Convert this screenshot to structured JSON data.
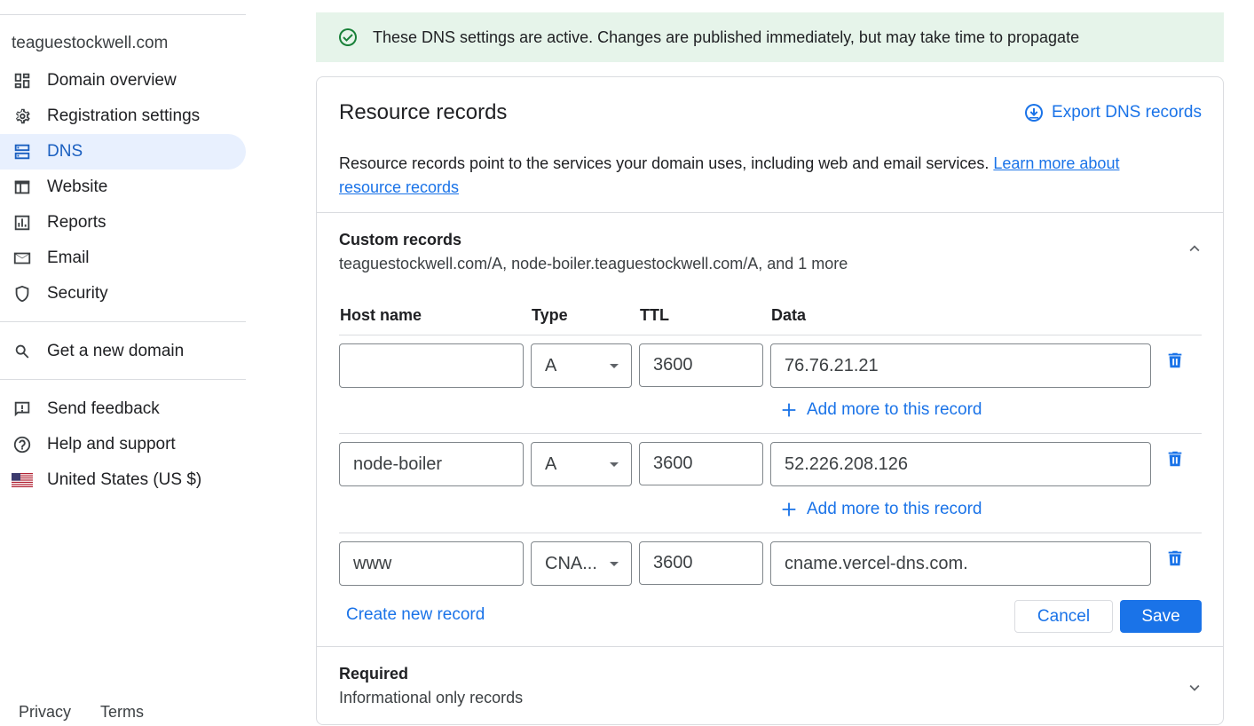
{
  "sidebar": {
    "domain": "teaguestockwell.com",
    "nav": [
      {
        "label": "Domain overview",
        "icon": "dashboard-icon"
      },
      {
        "label": "Registration settings",
        "icon": "gear-icon"
      },
      {
        "label": "DNS",
        "icon": "dns-icon",
        "active": true
      },
      {
        "label": "Website",
        "icon": "website-icon"
      },
      {
        "label": "Reports",
        "icon": "reports-icon"
      },
      {
        "label": "Email",
        "icon": "email-icon"
      },
      {
        "label": "Security",
        "icon": "shield-icon"
      }
    ],
    "get_domain": "Get a new domain",
    "send_feedback": "Send feedback",
    "help": "Help and support",
    "region": "United States (US $)",
    "privacy": "Privacy",
    "terms": "Terms"
  },
  "banner": {
    "text": "These DNS settings are active. Changes are published immediately, but may take time to propagate",
    "color": "#e6f4ea"
  },
  "card": {
    "title": "Resource records",
    "export_label": "Export DNS records",
    "description": "Resource records point to the services your domain uses, including web and email services. ",
    "learn_more_1": "Learn more about",
    "learn_more_2": "resource records",
    "custom": {
      "title": "Custom records",
      "summary": "teaguestockwell.com/A, node-boiler.teaguestockwell.com/A, and 1 more"
    },
    "columns": {
      "host": "Host name",
      "type": "Type",
      "ttl": "TTL",
      "data": "Data"
    },
    "records": [
      {
        "host": "",
        "type": "A",
        "ttl": "3600",
        "data": "76.76.21.21",
        "add_more": "Add more to this record"
      },
      {
        "host": "node-boiler",
        "type": "A",
        "ttl": "3600",
        "data": "52.226.208.126",
        "add_more": "Add more to this record"
      },
      {
        "host": "www",
        "type": "CNA...",
        "ttl": "3600",
        "data": "cname.vercel-dns.com."
      }
    ],
    "create_new": "Create new record",
    "cancel": "Cancel",
    "save": "Save",
    "required": {
      "title": "Required",
      "summary": "Informational only records"
    }
  },
  "colors": {
    "accent": "#1a73e8",
    "active_bg": "#e8f0fe",
    "success": "#188038"
  }
}
